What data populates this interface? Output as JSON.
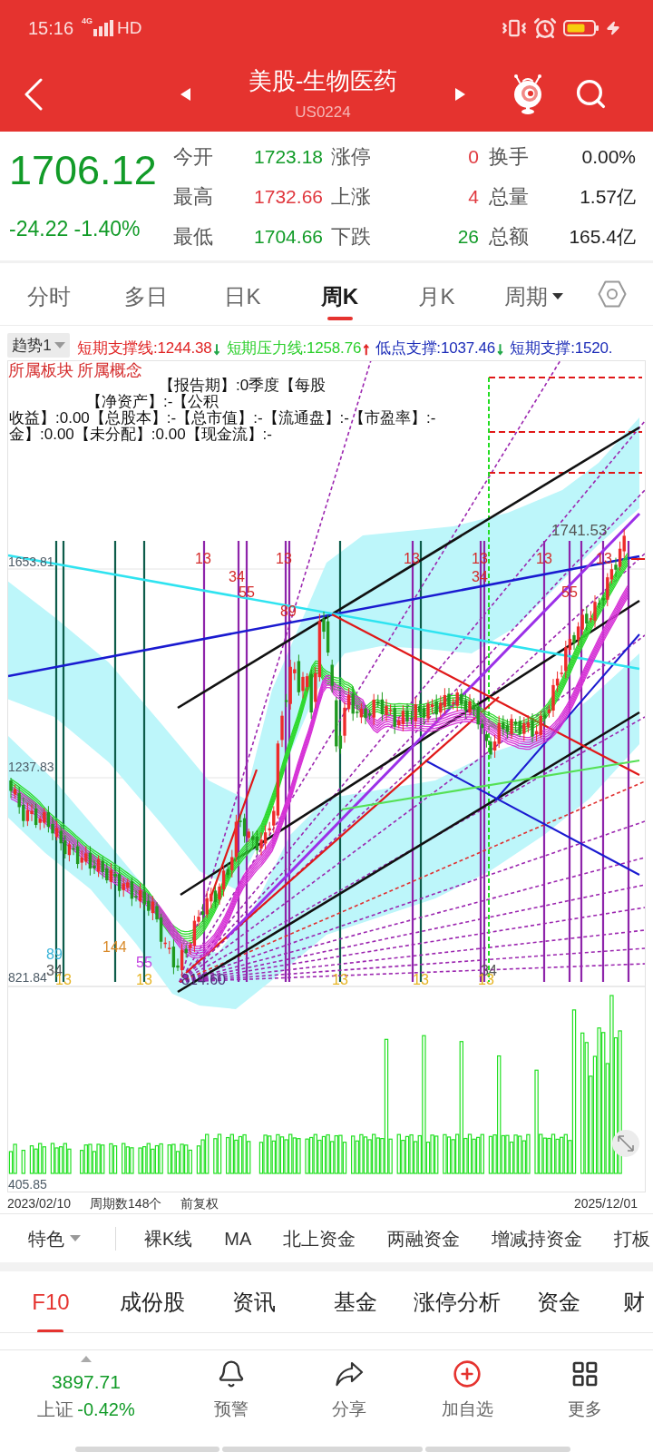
{
  "status_bar": {
    "time": "15:16",
    "network": "4G",
    "hd": "HD"
  },
  "header": {
    "title": "美股-生物医药",
    "code": "US0224"
  },
  "quote": {
    "price": "1706.12",
    "color": "#129b28",
    "change": "-24.22",
    "change_pct": "-1.40%",
    "stats": [
      {
        "label": "今开",
        "value": "1723.18",
        "color": "#129b28"
      },
      {
        "label": "最高",
        "value": "1732.66",
        "color": "#e0383e"
      },
      {
        "label": "最低",
        "value": "1704.66",
        "color": "#129b28"
      }
    ],
    "breadth": [
      {
        "label": "涨停",
        "count": "0",
        "color": "#e0383e"
      },
      {
        "label": "上涨",
        "count": "4",
        "color": "#e0383e"
      },
      {
        "label": "下跌",
        "count": "26",
        "color": "#129b28"
      }
    ],
    "totals": [
      {
        "label": "换手",
        "value": "0.00%"
      },
      {
        "label": "总量",
        "value": "1.57亿"
      },
      {
        "label": "总额",
        "value": "165.4亿"
      }
    ]
  },
  "period_tabs": [
    {
      "label": "分时",
      "selected": false,
      "kind": "tab"
    },
    {
      "label": "多日",
      "selected": false,
      "kind": "tab"
    },
    {
      "label": "日K",
      "selected": false,
      "kind": "tab"
    },
    {
      "label": "周K",
      "selected": true,
      "kind": "tab"
    },
    {
      "label": "月K",
      "selected": false,
      "kind": "tab"
    },
    {
      "label": "周期",
      "selected": false,
      "kind": "menu"
    }
  ],
  "indicator_bar": {
    "selector": "趋势1",
    "lines": [
      {
        "text": "短期支撑线:1244.38",
        "color": "#e02424",
        "arrow": {
          "text": "↓",
          "color": "#23a84a"
        }
      },
      {
        "text": "短期压力线:1258.76",
        "color": "#2bcf2b",
        "arrow": {
          "text": "↑",
          "color": "#e02424"
        }
      },
      {
        "text": "低点支撑:1037.46",
        "color": "#1c2cb8",
        "arrow": {
          "text": "↓",
          "color": "#23a84a"
        }
      },
      {
        "text": "短期支撑:1520.",
        "color": "#1c2cb8"
      }
    ]
  },
  "chart": {
    "concept_labels": [
      "所属板块",
      "所属概念"
    ],
    "info_lines": [
      "【报告期】:0季度【每股",
      "【净资产】:-【公积",
      "收益】:0.00【总股本】:-【总市值】:-【流通盘】:-【市盈率】:-",
      "金】:0.00【未分配】:0.00【现金流】:-"
    ],
    "price_labels": [
      "1653.81",
      "1237.83",
      "821.84"
    ],
    "high_label": "1741.53",
    "marks": [
      {
        "text": "13",
        "color": "#d42a2a"
      },
      {
        "text": "34",
        "color": "#d42a2a"
      },
      {
        "text": "55",
        "color": "#d42a2a"
      },
      {
        "text": "13",
        "color": "#d42a2a"
      },
      {
        "text": "89",
        "color": "#d42a2a"
      },
      {
        "text": "13",
        "color": "#d42a2a"
      },
      {
        "text": "13",
        "color": "#d42a2a"
      },
      {
        "text": "34",
        "color": "#d42a2a"
      },
      {
        "text": "13",
        "color": "#d42a2a"
      },
      {
        "text": "55",
        "color": "#d42a2a"
      },
      {
        "text": "13",
        "color": "#d42a2a"
      },
      {
        "text": "89",
        "color": "#3ab4d8"
      },
      {
        "text": "34",
        "color": "#555555"
      },
      {
        "text": "13",
        "color": "#e6b422"
      },
      {
        "text": "144",
        "color": "#d98a2a"
      },
      {
        "text": "55",
        "color": "#c23fe0"
      },
      {
        "text": "13",
        "color": "#e6b422"
      },
      {
        "text": "814.60",
        "color": "#4e2f7a"
      },
      {
        "text": "13",
        "color": "#e6b422"
      },
      {
        "text": "13",
        "color": "#e6b422"
      },
      {
        "text": "34",
        "color": "#555555"
      },
      {
        "text": "13",
        "color": "#e6b422"
      }
    ],
    "volume_label": "405.85",
    "start_date": "2023/02/10",
    "period_count": "周期数148个",
    "adjust": "前复权",
    "end_date": "2025/12/01"
  },
  "indicator_tabs": {
    "menu": "特色",
    "items": [
      "裸K线",
      "MA",
      "北上资金",
      "两融资金",
      "增减持资金",
      "打板"
    ]
  },
  "info_tabs": [
    {
      "label": "F10",
      "selected": true
    },
    {
      "label": "成份股",
      "selected": false
    },
    {
      "label": "资讯",
      "selected": false
    },
    {
      "label": "基金",
      "selected": false
    },
    {
      "label": "涨停分析",
      "selected": false
    },
    {
      "label": "资金",
      "selected": false
    },
    {
      "label": "财",
      "selected": false
    }
  ],
  "bottom_bar": {
    "index_value": "3897.71",
    "index_name": "上证",
    "index_change": "-0.42%",
    "color": "#129b28",
    "actions": [
      {
        "label": "预警",
        "kind": "alert"
      },
      {
        "label": "分享",
        "kind": "share"
      },
      {
        "label": "加自选",
        "kind": "add"
      },
      {
        "label": "更多",
        "kind": "more"
      }
    ]
  }
}
